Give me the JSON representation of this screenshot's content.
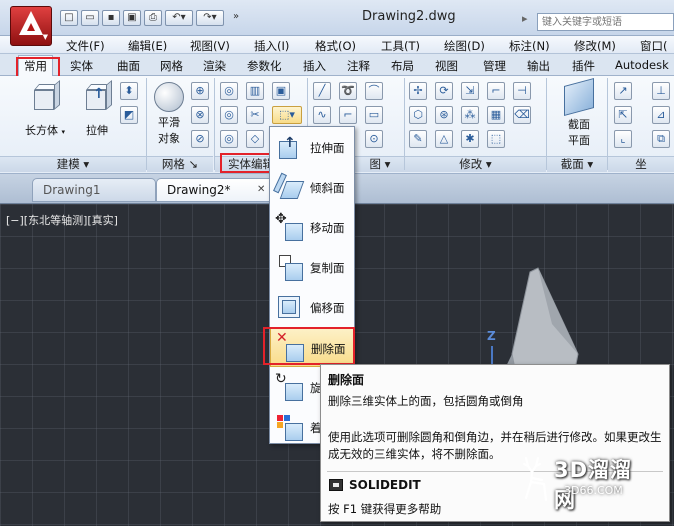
{
  "window": {
    "title": "Drawing2.dwg",
    "search_placeholder": "键入关键字或短语"
  },
  "qat": [
    "new-icon",
    "open-icon",
    "save-icon",
    "save-as-icon",
    "print-icon",
    "undo-icon",
    "redo-icon",
    "more-icon"
  ],
  "menu": [
    "文件(F)",
    "编辑(E)",
    "视图(V)",
    "插入(I)",
    "格式(O)",
    "工具(T)",
    "绘图(D)",
    "标注(N)",
    "修改(M)",
    "窗口("
  ],
  "ribbon_tabs": [
    "常用",
    "实体",
    "曲面",
    "网格",
    "渲染",
    "参数化",
    "插入",
    "注释",
    "布局",
    "视图",
    "管理",
    "输出",
    "插件",
    "Autodesk"
  ],
  "ribbon": {
    "box_label": "长方体",
    "extrude_label": "拉伸",
    "smooth_label_1": "平滑",
    "smooth_label_2": "对象",
    "section_label_1": "截面",
    "section_label_2": "平面",
    "panels": {
      "modeling": "建模",
      "mesh": "网格",
      "solid_edit": "实体编辑",
      "view_partial": "图",
      "modify": "修改",
      "section": "截面",
      "coord_partial": "坐"
    }
  },
  "doc_tabs": [
    "Drawing1",
    "Drawing2*"
  ],
  "viewport": {
    "label": "[−][东北等轴测][真实]",
    "axis": "Z"
  },
  "flyout": {
    "items": [
      {
        "label": "拉伸面",
        "icon": "extrude-face-icon"
      },
      {
        "label": "倾斜面",
        "icon": "taper-face-icon"
      },
      {
        "label": "移动面",
        "icon": "move-face-icon"
      },
      {
        "label": "复制面",
        "icon": "copy-face-icon"
      },
      {
        "label": "偏移面",
        "icon": "offset-face-icon"
      },
      {
        "label": "删除面",
        "icon": "delete-face-icon"
      },
      {
        "label": "旋",
        "icon": "rotate-face-icon"
      },
      {
        "label": "着",
        "icon": "color-face-icon"
      }
    ]
  },
  "tooltip": {
    "title": "删除面",
    "description": "删除三维实体上的面，包括圆角或倒角",
    "body": "使用此选项可删除圆角和倒角边，并在稍后进行修改。如果更改生成无效的三维实体，将不删除面。",
    "command": "SOLIDEDIT",
    "help": "按 F1 键获得更多帮助"
  },
  "watermark": {
    "brand": "3D溜溜网",
    "url": "3D66.COM"
  },
  "colors": {
    "highlight_red": "#e3222a",
    "viewport_bg": "#2b2f36",
    "hover_yellow": "#f9dc8a"
  }
}
